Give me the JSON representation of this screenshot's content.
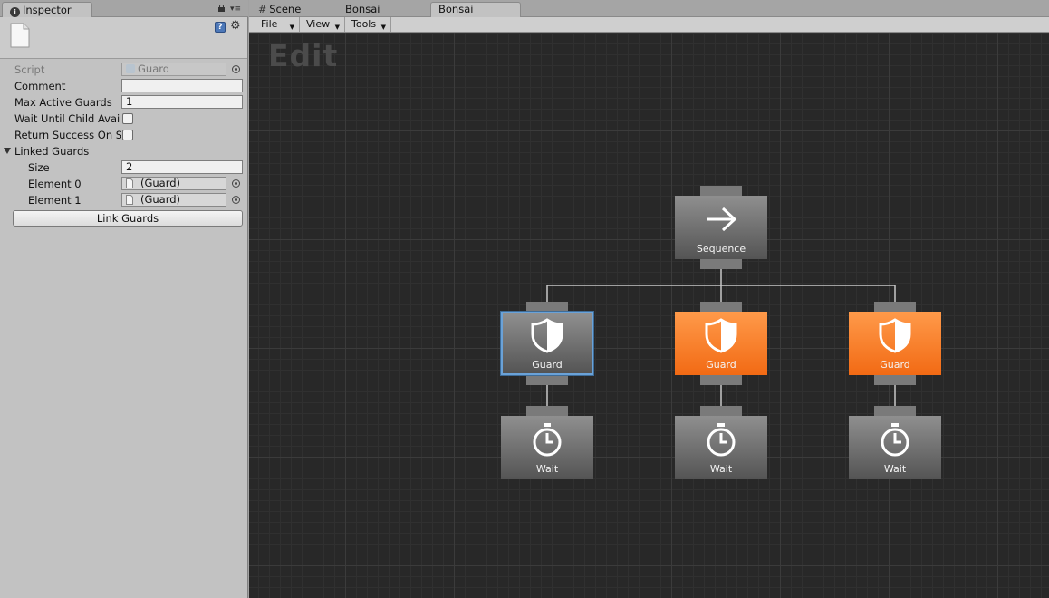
{
  "inspector": {
    "tab_label": "Inspector",
    "fields": {
      "script_label": "Script",
      "script_value": "Guard",
      "comment_label": "Comment",
      "comment_value": "",
      "max_active_label": "Max Active Guards",
      "max_active_value": "1",
      "wait_until_label": "Wait Until Child Avai",
      "return_success_label": "Return Success On S",
      "linked_guards_label": "Linked Guards",
      "size_label": "Size",
      "size_value": "2",
      "element0_label": "Element 0",
      "element0_value": "(Guard)",
      "element1_label": "Element 1",
      "element1_value": "(Guard)"
    },
    "link_button_label": "Link Guards"
  },
  "editor": {
    "tabs": [
      {
        "label": "Scene",
        "icon": "hash-icon"
      },
      {
        "label": "Bonsai"
      },
      {
        "label": "Bonsai",
        "active": true
      }
    ],
    "menus": [
      "File",
      "View",
      "Tools"
    ],
    "mode_label": "Edit",
    "nodes": {
      "sequence": {
        "label": "Sequence",
        "icon": "arrow-right-icon"
      },
      "guard_1": {
        "label": "Guard",
        "icon": "shield-icon",
        "state": "selected"
      },
      "guard_2": {
        "label": "Guard",
        "icon": "shield-icon",
        "state": "running"
      },
      "guard_3": {
        "label": "Guard",
        "icon": "shield-icon",
        "state": "running"
      },
      "wait_1": {
        "label": "Wait",
        "icon": "stopwatch-icon"
      },
      "wait_2": {
        "label": "Wait",
        "icon": "stopwatch-icon"
      },
      "wait_3": {
        "label": "Wait",
        "icon": "stopwatch-icon"
      }
    }
  },
  "colors": {
    "running": "#f26a14",
    "selected_outline": "#6aa2d8",
    "canvas": "#282828",
    "wire": "#c8c8c8"
  }
}
